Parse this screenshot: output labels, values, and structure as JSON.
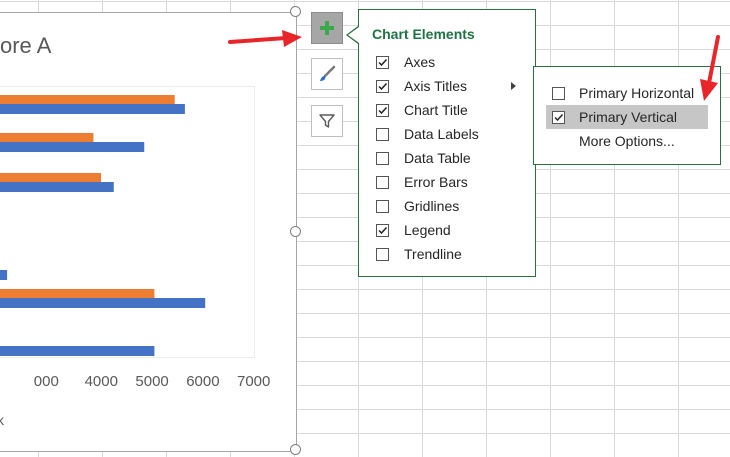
{
  "chart": {
    "title_partial": "ore A",
    "axis_title_partial": "k"
  },
  "chart_data": {
    "type": "bar",
    "orientation": "horizontal",
    "x_ticks": [
      "000",
      "4000",
      "5000",
      "6000",
      "7000"
    ],
    "xlim": [
      2000,
      7000
    ],
    "series": [
      {
        "color": "#ed7d31",
        "values": [
          5400,
          3800,
          3950,
          null,
          null,
          5000,
          null
        ]
      },
      {
        "color": "#4472c4",
        "values": [
          5600,
          4800,
          4200,
          null,
          2100,
          6000,
          5000
        ]
      }
    ]
  },
  "panel": {
    "title": "Chart Elements",
    "items": [
      {
        "label": "Axes",
        "checked": true
      },
      {
        "label": "Axis Titles",
        "checked": true,
        "has_submenu": true
      },
      {
        "label": "Chart Title",
        "checked": true
      },
      {
        "label": "Data Labels",
        "checked": false
      },
      {
        "label": "Data Table",
        "checked": false
      },
      {
        "label": "Error Bars",
        "checked": false
      },
      {
        "label": "Gridlines",
        "checked": false
      },
      {
        "label": "Legend",
        "checked": true
      },
      {
        "label": "Trendline",
        "checked": false
      }
    ]
  },
  "submenu": {
    "items": [
      {
        "label": "Primary Horizontal",
        "checked": false,
        "highlighted": false
      },
      {
        "label": "Primary Vertical",
        "checked": true,
        "highlighted": true
      },
      {
        "label": "More Options...",
        "checkbox": false
      }
    ]
  },
  "icons": {
    "add_elements": "plus-icon",
    "styles": "paintbrush-icon",
    "filters": "funnel-icon"
  },
  "colors": {
    "accent_green": "#217346",
    "orange_series": "#ed7d31",
    "blue_series": "#4472c4",
    "annotation_red": "#e8262a"
  }
}
